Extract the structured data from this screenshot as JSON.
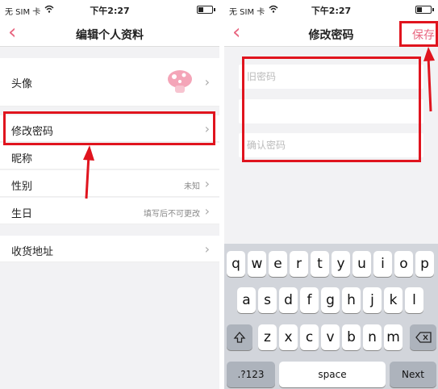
{
  "left": {
    "status": {
      "carrier": "无 SIM 卡",
      "time": "下午2:27"
    },
    "nav": {
      "back": "‹",
      "title": "编辑个人资料"
    },
    "rows": {
      "avatar": {
        "label": "头像"
      },
      "password": {
        "label": "修改密码"
      },
      "nickname": {
        "label": "昵称"
      },
      "gender": {
        "label": "性别",
        "value": "未知"
      },
      "birthday": {
        "label": "生日",
        "value": "填写后不可更改"
      },
      "address": {
        "label": "收货地址"
      }
    }
  },
  "right": {
    "status": {
      "carrier": "无 SIM 卡",
      "time": "下午2:27"
    },
    "nav": {
      "back": "‹",
      "title": "修改密码",
      "save": "保存"
    },
    "fields": {
      "old_placeholder": "旧密码",
      "new_placeholder": "",
      "confirm_placeholder": "确认密码"
    },
    "keyboard": {
      "row1": [
        "q",
        "w",
        "e",
        "r",
        "t",
        "y",
        "u",
        "i",
        "o",
        "p"
      ],
      "row2": [
        "a",
        "s",
        "d",
        "f",
        "g",
        "h",
        "j",
        "k",
        "l"
      ],
      "row3": [
        "z",
        "x",
        "c",
        "v",
        "b",
        "n",
        "m"
      ],
      "numbers": ".?123",
      "space": "space",
      "next": "Next"
    }
  },
  "colors": {
    "accent": "#e8657f",
    "highlight": "#e0141e",
    "keyboard_bg": "#d2d5db"
  },
  "icons": [
    "chevron-left-icon",
    "chevron-right-icon",
    "shift-icon",
    "backspace-icon",
    "wifi-icon",
    "battery-icon"
  ]
}
